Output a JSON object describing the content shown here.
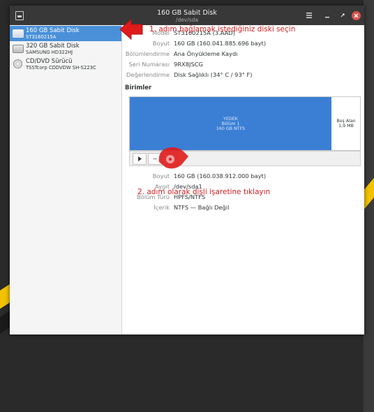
{
  "window": {
    "title": "160 GB Sabit Disk",
    "subtitle": "/dev/sda"
  },
  "titlebar_icons": {
    "menu": "hamburger-menu-icon",
    "minimize": "minimize-icon",
    "maximize": "maximize-icon",
    "close": "close-icon"
  },
  "sidebar": {
    "items": [
      {
        "name": "160 GB Sabit Disk",
        "model": "ST3160215A",
        "icon": "hard-disk-icon",
        "selected": true
      },
      {
        "name": "320 GB Sabit Disk",
        "model": "SAMSUNG HD322HJ",
        "icon": "hard-disk-icon",
        "selected": false
      },
      {
        "name": "CD/DVD Sürücü",
        "model": "TSSTcorp CDDVDW SH-S223C",
        "icon": "optical-drive-icon",
        "selected": false
      }
    ]
  },
  "disk_properties": [
    {
      "label": "Model",
      "value": "ST3160215A (3.AAD)"
    },
    {
      "label": "Boyut",
      "value": "160 GB (160.041.885.696 bayt)"
    },
    {
      "label": "Bölümlendirme",
      "value": "Ana Önyükleme Kaydı"
    },
    {
      "label": "Seri Numarası",
      "value": "9RX8JSCG"
    },
    {
      "label": "Değerlendirme",
      "value": "Disk Sağlıklı (34° C / 93° F)"
    }
  ],
  "volumes": {
    "title": "Birimler",
    "partition": {
      "name": "YEDEK",
      "number": "Bölüm 1",
      "size": "160 GB NTFS"
    },
    "free_space": {
      "label": "Boş Alan",
      "size": "1,9 MB"
    }
  },
  "volume_toolbar": {
    "play_icon": "play-icon",
    "minus_label": "−",
    "gear_icon": "gear-icon"
  },
  "volume_properties": [
    {
      "label": "Boyut",
      "value": "160 GB (160.038.912.000 bayt)"
    },
    {
      "label": "Aygıt",
      "value": "/dev/sda1"
    },
    {
      "label": "Bölüm Türü",
      "value": "HPFS/NTFS"
    },
    {
      "label": "İçerik",
      "value": "NTFS — Bağlı Değil"
    }
  ],
  "annotations": {
    "step1": "1. adım bağlamak istediğiniz diski seçin",
    "step2": "2. adım olarak dişli işaretine tıklayın",
    "color": "#d42020"
  },
  "colors": {
    "selection": "#4a90d9",
    "partition": "#3b7fd5",
    "titlebar": "#383838",
    "close_button": "#d9534f"
  }
}
